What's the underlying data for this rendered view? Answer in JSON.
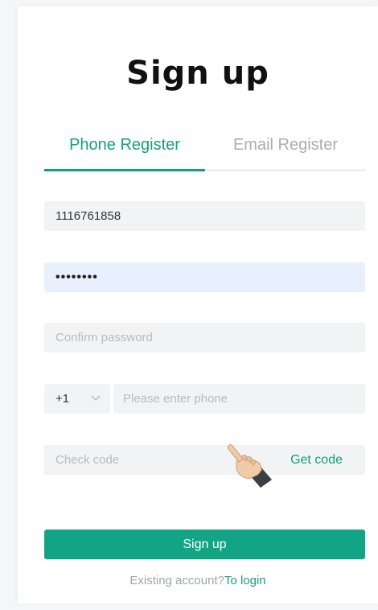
{
  "title": "Sign up",
  "tabs": [
    {
      "label": "Phone Register",
      "active": true
    },
    {
      "label": "Email Register",
      "active": false
    }
  ],
  "form": {
    "account_value": "1116761858",
    "password_value": "••••••••",
    "confirm_placeholder": "Confirm password",
    "country_code": "+1",
    "phone_placeholder": "Please enter phone",
    "code_placeholder": "Check code",
    "get_code_label": "Get code"
  },
  "submit_label": "Sign up",
  "footer": {
    "prompt": "Existing account?",
    "login_link": "To login"
  },
  "colors": {
    "accent": "#15a07a",
    "button": "#12a585",
    "input_bg": "#f1f3f4",
    "autofill_bg": "#e8f0fe"
  },
  "cursor_icon": "pointing-hand-icon"
}
